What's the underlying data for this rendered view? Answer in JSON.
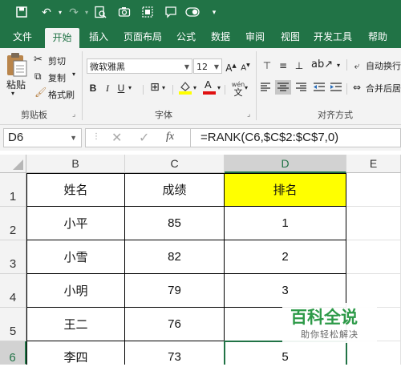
{
  "ribbon_tabs": [
    "文件",
    "开始",
    "插入",
    "页面布局",
    "公式",
    "数据",
    "审阅",
    "视图",
    "开发工具",
    "帮助"
  ],
  "active_tab": "开始",
  "clipboard": {
    "paste": "粘贴",
    "cut": "剪切",
    "copy": "复制",
    "format_painter": "格式刷",
    "group_label": "剪贴板"
  },
  "font": {
    "name": "微软雅黑",
    "size": "12",
    "bold": "B",
    "italic": "I",
    "underline": "U",
    "group_label": "字体",
    "grow": "A",
    "shrink": "A",
    "font_color": "A",
    "wen": "wén"
  },
  "alignment": {
    "wrap_text": "自动换行",
    "merge_center": "合并后居",
    "group_label": "对齐方式"
  },
  "name_box": "D6",
  "fx_label": "fx",
  "formula": "=RANK(C6,$C$2:$C$7,0)",
  "columns": [
    "B",
    "C",
    "D",
    "E"
  ],
  "rows": [
    "1",
    "2",
    "3",
    "4",
    "5",
    "6"
  ],
  "sheet": {
    "header": [
      "姓名",
      "成绩",
      "排名"
    ],
    "data": [
      [
        "小平",
        "85",
        "1"
      ],
      [
        "小雪",
        "82",
        "2"
      ],
      [
        "小明",
        "79",
        "3"
      ],
      [
        "王二",
        "76",
        ""
      ],
      [
        "李四",
        "73",
        "5"
      ]
    ]
  },
  "colors": {
    "excel_green": "#217346",
    "highlight": "#ffff00",
    "watermark_green": "#2d9a48"
  },
  "watermark": {
    "title": "百科全说",
    "subtitle": "助你轻松解决"
  }
}
